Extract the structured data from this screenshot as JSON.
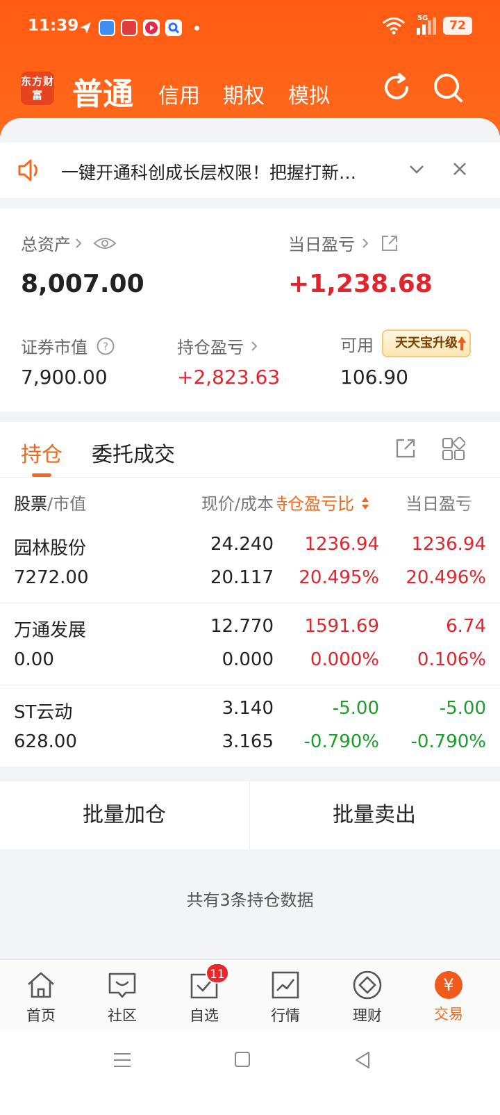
{
  "status_bar": {
    "time": "11:39",
    "network": "5G",
    "battery": "72"
  },
  "header": {
    "logo_text": "东方财富",
    "tabs": [
      {
        "label": "普通",
        "active": true
      },
      {
        "label": "信用",
        "active": false
      },
      {
        "label": "期权",
        "active": false
      },
      {
        "label": "模拟",
        "active": false
      }
    ],
    "icons": [
      "refresh-icon",
      "search-icon"
    ]
  },
  "notice": {
    "text": "一键开通科创成长层权限！把握打新…"
  },
  "assets": {
    "total_label": "总资产",
    "total_value": "8,007.00",
    "day_pl_label": "当日盈亏",
    "day_pl_value": "+1,238.68",
    "market_value_label": "证券市值",
    "market_value": "7,900.00",
    "position_pl_label": "持仓盈亏",
    "position_pl": "+2,823.63",
    "available_label": "可用",
    "available": "106.90",
    "upgrade_label": "天天宝升级"
  },
  "holdings": {
    "tabs": [
      {
        "label": "持仓",
        "active": true
      },
      {
        "label": "委托成交",
        "active": false
      }
    ],
    "columns": {
      "stock": "股票",
      "market_value": "/市值",
      "price_cost": "现价/成本",
      "pl_ratio": "持仓盈亏比",
      "day_pl": "当日盈亏"
    },
    "rows": [
      {
        "name": "园林股份",
        "market_value": "7272.00",
        "price": "24.240",
        "cost": "20.117",
        "pl": "1236.94",
        "pl_pct": "20.495%",
        "day_pl": "1236.94",
        "day_pct": "20.496%",
        "color": "red"
      },
      {
        "name": "万通发展",
        "market_value": "0.00",
        "price": "12.770",
        "cost": "0.000",
        "pl": "1591.69",
        "pl_pct": "0.000%",
        "day_pl": "6.74",
        "day_pct": "0.106%",
        "color": "red"
      },
      {
        "name": "ST云动",
        "market_value": "628.00",
        "price": "3.140",
        "cost": "3.165",
        "pl": "-5.00",
        "pl_pct": "-0.790%",
        "day_pl": "-5.00",
        "day_pct": "-0.790%",
        "color": "green"
      }
    ]
  },
  "batch": {
    "add": "批量加仓",
    "sell": "批量卖出"
  },
  "summary": {
    "count_text": "共有3条持仓数据"
  },
  "tabbar": {
    "items": [
      {
        "label": "首页",
        "icon": "home-icon"
      },
      {
        "label": "社区",
        "icon": "community-icon"
      },
      {
        "label": "自选",
        "icon": "watchlist-icon",
        "badge": "11"
      },
      {
        "label": "行情",
        "icon": "market-icon"
      },
      {
        "label": "理财",
        "icon": "wealth-icon"
      },
      {
        "label": "交易",
        "icon": "trade-icon",
        "active": true
      }
    ],
    "trade_glyph": "¥"
  },
  "colors": {
    "brand": "#ff5a12",
    "accent": "#ef6a1b",
    "up": "#e0262c",
    "down": "#1a9e2a"
  }
}
